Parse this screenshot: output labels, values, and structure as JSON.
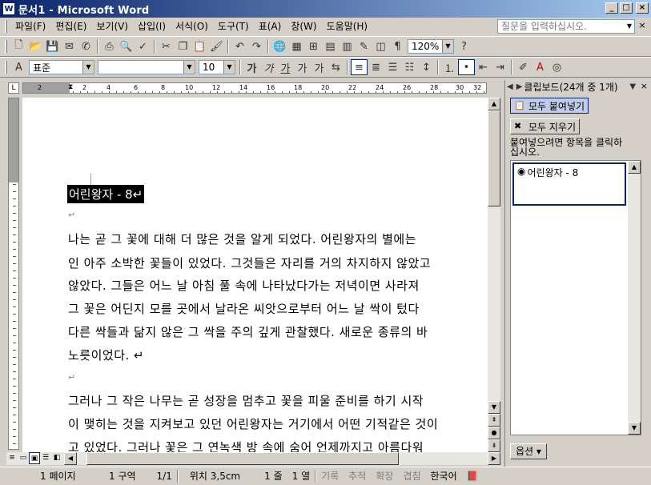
{
  "window": {
    "title": "문서1 - Microsoft Word",
    "icon_text": "W",
    "buttons": [
      "_",
      "□",
      "×"
    ]
  },
  "menu": {
    "items": [
      "파일(F)",
      "편집(E)",
      "보기(V)",
      "삽입(I)",
      "서식(O)",
      "도구(T)",
      "표(A)",
      "창(W)",
      "도움말(H)"
    ],
    "help_placeholder": "질문을 입력하십시오."
  },
  "toolbar1": {
    "zoom": "120%"
  },
  "toolbar2": {
    "style": "표준",
    "font": "",
    "size": "10",
    "format_buttons": [
      "가",
      "가",
      "가",
      "가",
      "가"
    ]
  },
  "ruler": {
    "labels": [
      "2",
      "2",
      "4",
      "6",
      "8",
      "10",
      "12",
      "14",
      "16",
      "18",
      "20",
      "22",
      "24",
      "26",
      "28",
      "30",
      "32"
    ]
  },
  "document": {
    "title": "어린왕자 - 8↵",
    "lines": [
      "나는 곧 그 꽃에 대해 더 많은 것을 알게 되었다. 어린왕자의 별에는",
      "인 아주 소박한 꽃들이 있었다. 그것들은 자리를 거의 차지하지 않았고",
      "않았다. 그들은 어느 날 아침 풀 속에 나타났다가는 저녁이면 사라져",
      "그 꽃은 어딘지 모를 곳에서 날라온 씨앗으로부터 어느 날 싹이 텄다",
      "다른 싹들과 닮지 않은 그 싹을 주의 깊게 관찰했다. 새로운 종류의 바",
      "노릇이었다. ↵",
      "그러나 그 작은 나무는 곧 성장을 멈추고 꽃을 피울 준비를 하기 시작",
      "이 맺히는 것을 지켜보고 있던 어린왕자는 거기에서 어떤 기적같은 것이",
      "고 있었다. 그러나 꽃은 그 연녹색 방 속에 숨어 언제까지고 아름다워"
    ],
    "para_mark": "↵"
  },
  "taskpane": {
    "title": "클립보드(24개 중 1개)",
    "paste_all": "모두 붙여넣기",
    "clear_all": "모두 지우기",
    "hint": "붙여넣으려면 항목을 클릭하십시오.",
    "clip_item": "어린왕자 - 8",
    "options": "옵션 ▾"
  },
  "status": {
    "page": "1 페이지",
    "section": "1 구역",
    "pages": "1/1",
    "position": "위치 3,5cm",
    "line": "1 줄",
    "column": "1 열",
    "rec": "기록",
    "track": "추적",
    "ext": "확장",
    "ovr": "겹침",
    "lang": "한국어"
  }
}
